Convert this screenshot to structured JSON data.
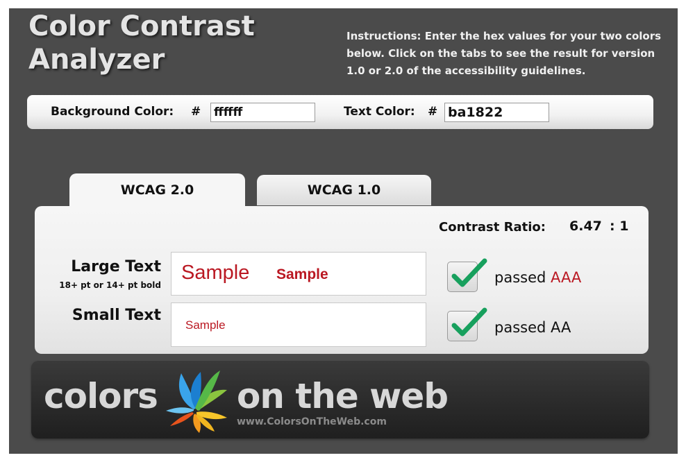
{
  "header": {
    "title": "Color Contrast\nAnalyzer",
    "instructions": "Instructions: Enter the hex values for your two colors below. Click on the tabs to see the result for version 1.0 or 2.0 of the accessibility guidelines."
  },
  "colors": {
    "background_label": "Background Color:",
    "background_hash": "#",
    "background_value": "ffffff",
    "text_label": "Text Color:",
    "text_hash": "#",
    "text_value": "ba1822"
  },
  "tabs": [
    {
      "label": "WCAG 2.0",
      "active": true
    },
    {
      "label": "WCAG 1.0",
      "active": false
    }
  ],
  "results": {
    "ratio_label": "Contrast Ratio:",
    "ratio_value": "6.47",
    "ratio_suffix": ": 1",
    "large": {
      "label": "Large Text",
      "sub": "18+ pt or 14+ pt bold",
      "sample_normal": "Sample",
      "sample_bold": "Sample",
      "status_prefix": "passed",
      "status_level": "AAA"
    },
    "small": {
      "label": "Small Text",
      "sample": "Sample",
      "status_prefix": "passed",
      "status_level": "AA"
    }
  },
  "footer": {
    "word1": "colors",
    "word2": "on the web",
    "url": "www.ColorsOnTheWeb.com"
  },
  "theme": {
    "sample_color": "#ba1822",
    "check_color": "#17a05d",
    "app_bg": "#4b4b4b"
  }
}
